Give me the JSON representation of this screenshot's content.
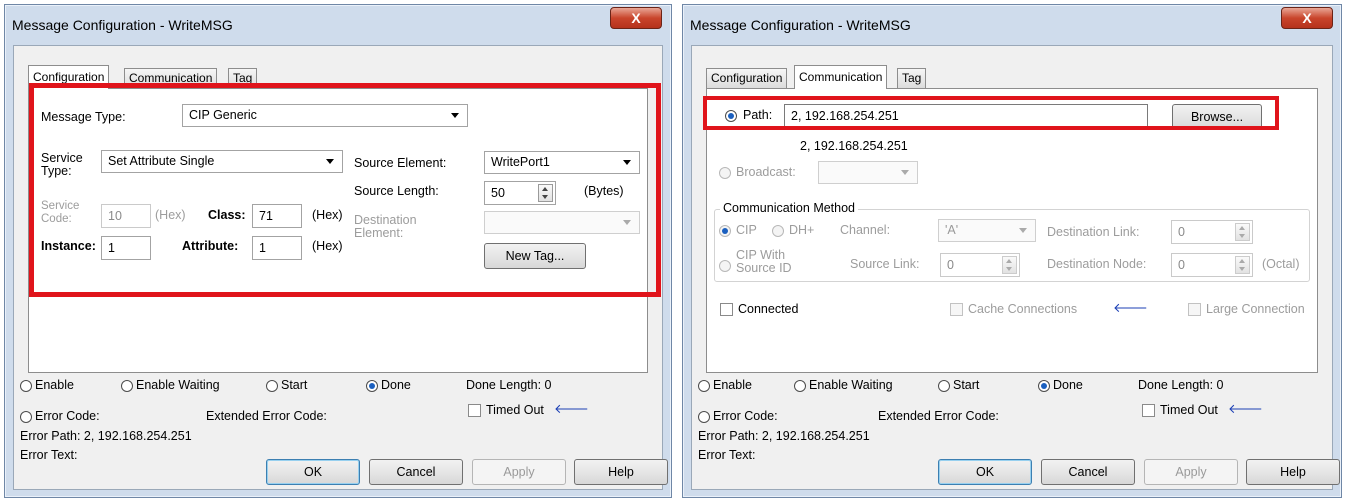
{
  "left_dialog": {
    "title": "Message Configuration - WriteMSG",
    "close_label": "X",
    "tabs": [
      "Configuration",
      "Communication",
      "Tag"
    ],
    "message_type_label": "Message Type:",
    "message_type_value": "CIP Generic",
    "service_type_label": "Service\nType:",
    "service_type_value": "Set Attribute Single",
    "service_code_label": "Service\nCode:",
    "service_code_value": "10",
    "hex_label_gray": "(Hex)",
    "class_label": "Class:",
    "class_value": "71",
    "hex_label_1": "(Hex)",
    "instance_label": "Instance:",
    "instance_value": "1",
    "attribute_label": "Attribute:",
    "attribute_value": "1",
    "hex_label_2": "(Hex)",
    "source_element_label": "Source Element:",
    "source_element_value": "WritePort1",
    "source_length_label": "Source Length:",
    "source_length_value": "50",
    "bytes_label": "(Bytes)",
    "destination_element_label": "Destination\nElement:",
    "destination_element_value": "",
    "new_tag_label": "New Tag...",
    "status": {
      "enable": "Enable",
      "enable_waiting": "Enable Waiting",
      "start": "Start",
      "done": "Done",
      "done_length": "Done Length: 0",
      "error_code": "Error Code:",
      "extended_error_code": "Extended Error Code:",
      "timed_out": "Timed Out",
      "error_path": "Error Path: 2, 192.168.254.251",
      "error_text": "Error Text:"
    },
    "buttons": {
      "ok": "OK",
      "cancel": "Cancel",
      "apply": "Apply",
      "help": "Help"
    }
  },
  "right_dialog": {
    "title": "Message Configuration - WriteMSG",
    "close_label": "X",
    "tabs": [
      "Configuration",
      "Communication",
      "Tag"
    ],
    "path_label": "Path:",
    "path_value": "2, 192.168.254.251",
    "browse_label": "Browse...",
    "path_resolved": "2, 192.168.254.251",
    "broadcast_label": "Broadcast:",
    "comm_method_label": "Communication Method",
    "cip_label": "CIP",
    "dh_label": "DH+",
    "channel_label": "Channel:",
    "channel_value": "'A'",
    "dest_link_label": "Destination Link:",
    "dest_link_value": "0",
    "cip_source_label": "CIP With\nSource ID",
    "source_link_label": "Source Link:",
    "source_link_value": "0",
    "dest_node_label": "Destination Node:",
    "dest_node_value": "0",
    "octal_label": "(Octal)",
    "connected_label": "Connected",
    "cache_label": "Cache Connections",
    "large_label": "Large Connection",
    "status": {
      "enable": "Enable",
      "enable_waiting": "Enable Waiting",
      "start": "Start",
      "done": "Done",
      "done_length": "Done Length: 0",
      "error_code": "Error Code:",
      "extended_error_code": "Extended Error Code:",
      "timed_out": "Timed Out",
      "error_path": "Error Path: 2, 192.168.254.251",
      "error_text": "Error Text:"
    },
    "buttons": {
      "ok": "OK",
      "cancel": "Cancel",
      "apply": "Apply",
      "help": "Help"
    }
  },
  "colors": {
    "highlight": "#e0141b",
    "window_frame": "#cfdcec",
    "radio_selected": "#1a5fbf",
    "arrow_icon": "#1b3fb5"
  }
}
